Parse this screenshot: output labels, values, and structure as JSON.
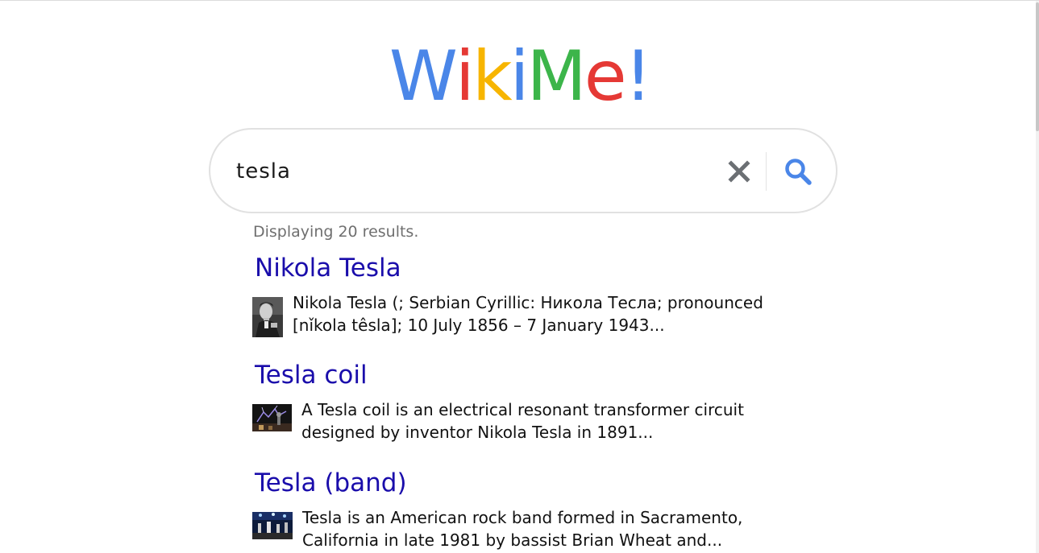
{
  "logo": {
    "letters": [
      {
        "char": "W",
        "color": "#4a86e8"
      },
      {
        "char": "i",
        "color": "#e53935"
      },
      {
        "char": "k",
        "color": "#f7b500"
      },
      {
        "char": "i",
        "color": "#4a86e8"
      },
      {
        "char": "M",
        "color": "#3cb54a"
      },
      {
        "char": "e",
        "color": "#e53935"
      },
      {
        "char": "!",
        "color": "#4a86e8"
      }
    ]
  },
  "search": {
    "value": "tesla",
    "clear_icon_color": "#6b6f73",
    "search_icon_color": "#4a86e8"
  },
  "results_info": {
    "count_text": "Displaying 20 results."
  },
  "results": [
    {
      "title": "Nikola Tesla",
      "snippet_line1": "Nikola Tesla (; Serbian Cyrillic: Никола Тесла; pronounced",
      "snippet_line2": "[nǐkola têsla]; 10 July 1856 – 7 January 1943..."
    },
    {
      "title": "Tesla coil",
      "snippet_line1": "A Tesla coil is an electrical resonant transformer circuit",
      "snippet_line2": "designed by inventor Nikola Tesla in 1891..."
    },
    {
      "title": "Tesla (band)",
      "snippet_line1": "Tesla is an American rock band formed in Sacramento,",
      "snippet_line2": "California in late 1981 by bassist Brian Wheat and..."
    }
  ],
  "colors": {
    "link": "#1a0dab",
    "muted_text": "#6f6f6f"
  }
}
